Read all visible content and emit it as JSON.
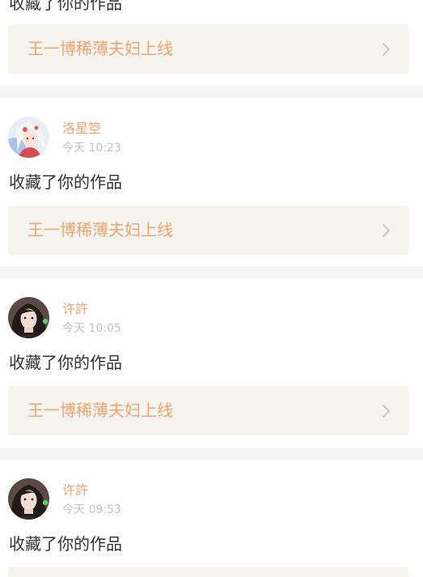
{
  "feed": [
    {
      "action": "收藏了你的作品",
      "work_title": "王一博稀薄夫妇上线"
    },
    {
      "user_name": "洛星箜",
      "time": "今天 10:23",
      "avatar_icon": "anime-girl-avatar-icon",
      "action": "收藏了你的作品",
      "work_title": "王一博稀薄夫妇上线"
    },
    {
      "user_name": "许許",
      "time": "今天 10:05",
      "avatar_icon": "girl-photo-avatar-icon",
      "online": true,
      "action": "收藏了你的作品",
      "work_title": "王一博稀薄夫妇上线"
    },
    {
      "user_name": "许許",
      "time": "今天 09:53",
      "avatar_icon": "girl-photo-avatar-icon",
      "online": true,
      "action": "收藏了你的作品"
    }
  ],
  "colors": {
    "accent": "#f0a36f",
    "card_bg": "#f5f4ee",
    "separator": "#f5f5f5",
    "time_gray": "#c2c2c2",
    "text_dark": "#333333",
    "online_green": "#4cd964"
  }
}
